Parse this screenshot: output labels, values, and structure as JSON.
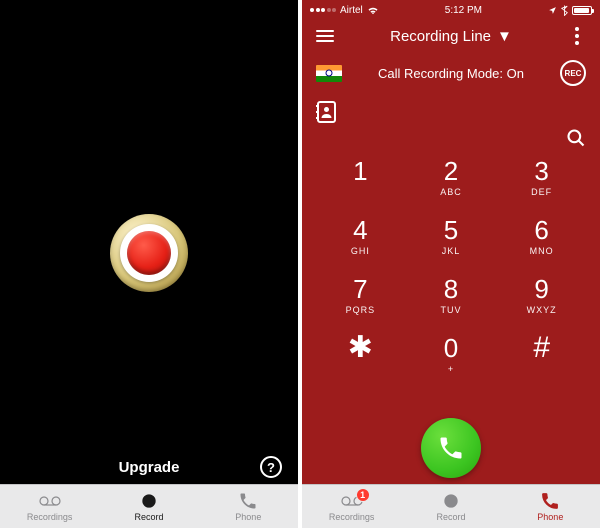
{
  "left": {
    "upgrade_label": "Upgrade",
    "help_symbol": "?",
    "tabs": [
      {
        "label": "Recordings"
      },
      {
        "label": "Record"
      },
      {
        "label": "Phone"
      }
    ]
  },
  "right": {
    "status": {
      "carrier": "Airtel",
      "time": "5:12 PM"
    },
    "title": "Recording Line",
    "mode_text": "Call Recording Mode: On",
    "rec_badge": "REC",
    "keys": [
      {
        "digit": "1",
        "letters": ""
      },
      {
        "digit": "2",
        "letters": "ABC"
      },
      {
        "digit": "3",
        "letters": "DEF"
      },
      {
        "digit": "4",
        "letters": "GHI"
      },
      {
        "digit": "5",
        "letters": "JKL"
      },
      {
        "digit": "6",
        "letters": "MNO"
      },
      {
        "digit": "7",
        "letters": "PQRS"
      },
      {
        "digit": "8",
        "letters": "TUV"
      },
      {
        "digit": "9",
        "letters": "WXYZ"
      },
      {
        "digit": "✱",
        "letters": ""
      },
      {
        "digit": "0",
        "letters": "+"
      },
      {
        "digit": "#",
        "letters": ""
      }
    ],
    "tabs": [
      {
        "label": "Recordings",
        "badge": "1"
      },
      {
        "label": "Record"
      },
      {
        "label": "Phone"
      }
    ]
  }
}
